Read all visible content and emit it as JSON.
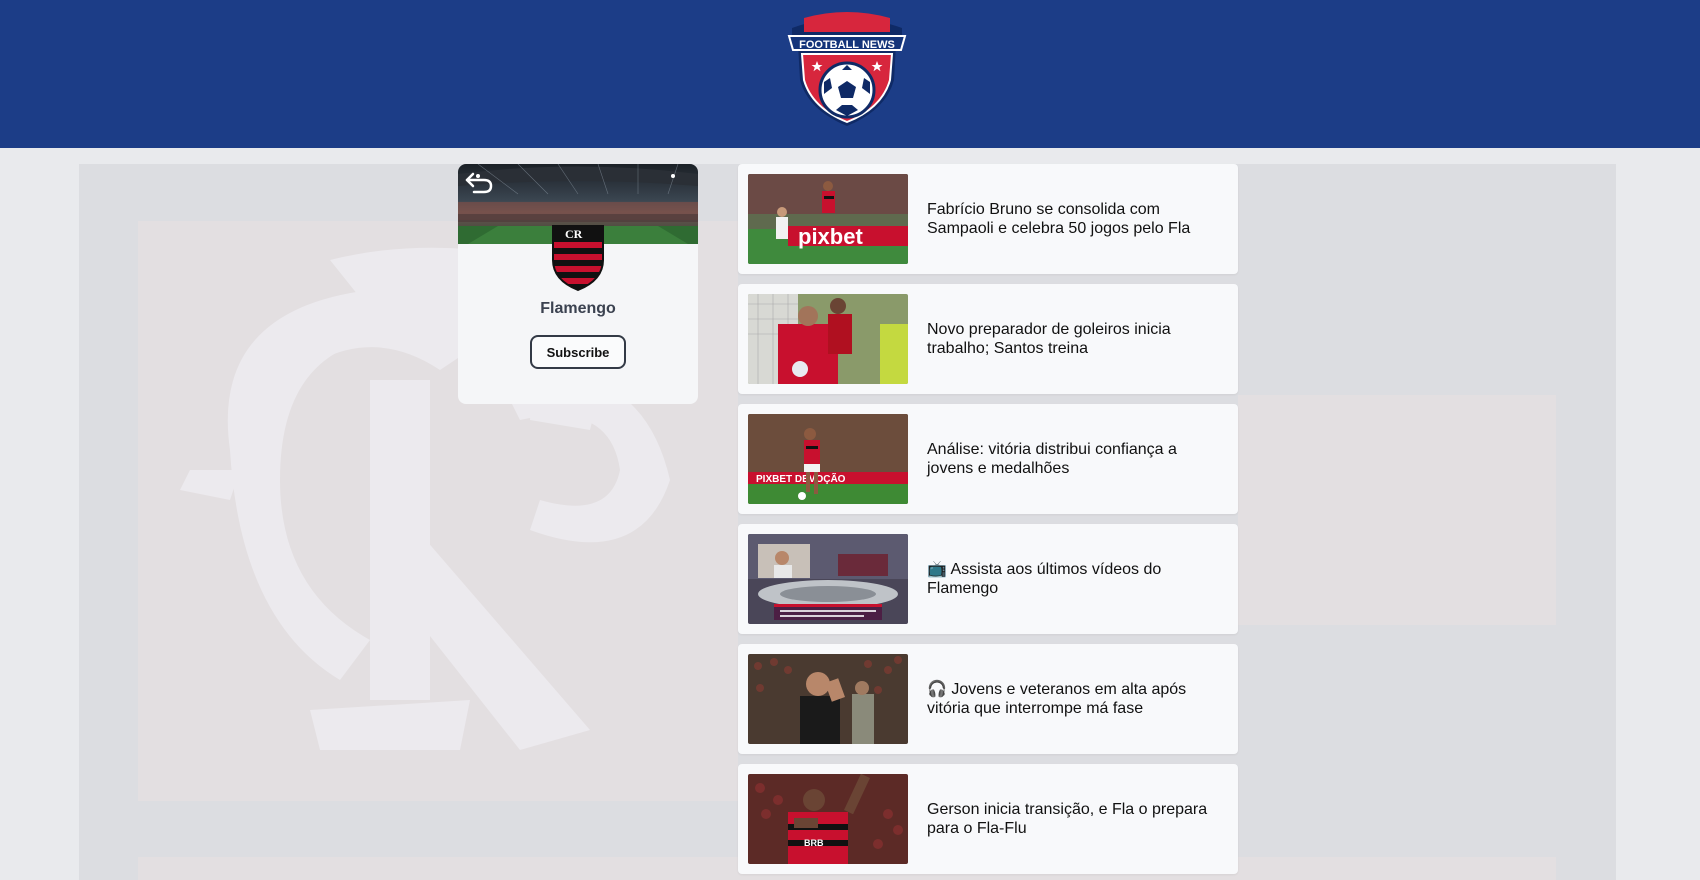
{
  "header": {
    "logo_text": "FOOTBALL NEWS"
  },
  "club": {
    "name": "Flamengo",
    "subscribe_label": "Subscribe"
  },
  "news": [
    {
      "title": "Fabrício Bruno se consolida com Sampaoli e celebra 50 jogos pelo Fla",
      "thumb": "green-white-player-and-red-black-player"
    },
    {
      "title": "Novo preparador de goleiros inicia trabalho; Santos treina",
      "thumb": "goalkeeper-training"
    },
    {
      "title": "Análise: vitória distribui confiança a jovens e medalhões",
      "thumb": "player-dribbling"
    },
    {
      "title": "📺 Assista aos últimos vídeos do Flamengo",
      "thumb": "tv-studio"
    },
    {
      "title": "🎧 Jovens e veteranos em alta após vitória que interrompe má fase",
      "thumb": "coach-on-sideline"
    },
    {
      "title": "Gerson inicia transição, e Fla o prepara para o Fla-Flu",
      "thumb": "player-celebrating"
    }
  ],
  "colors": {
    "header": "#1c3d87",
    "flamengo_red": "#c8102e",
    "flamengo_black": "#111111"
  }
}
